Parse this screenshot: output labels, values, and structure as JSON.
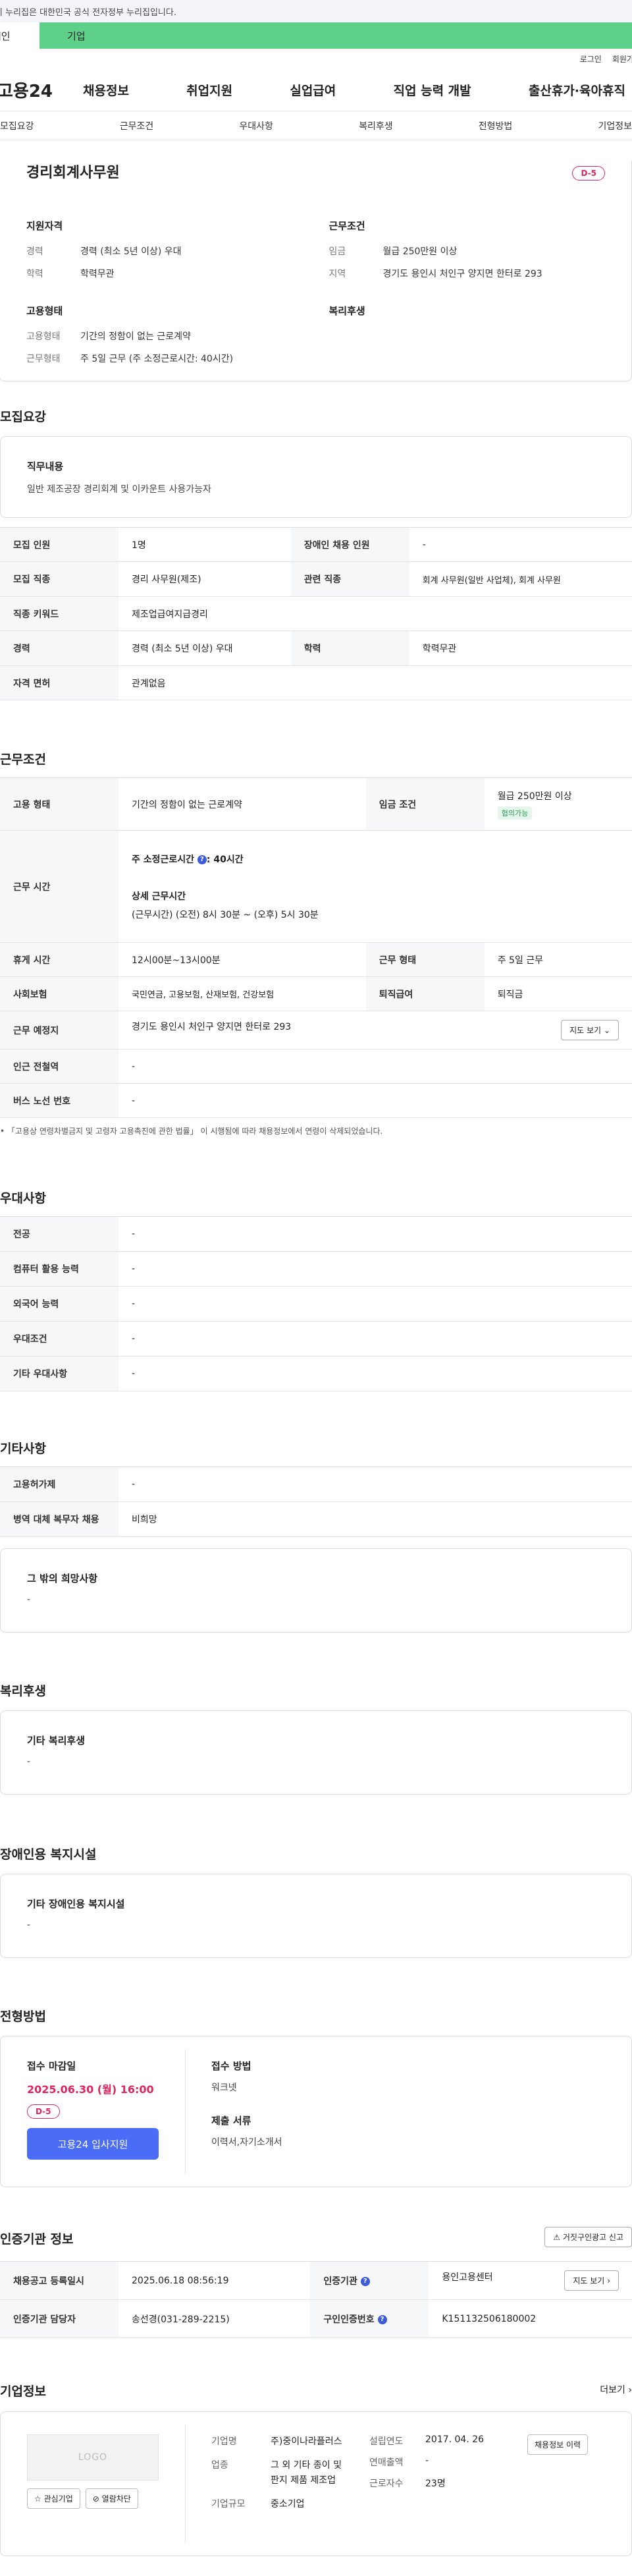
{
  "gov_banner": "이 누리집은 대한민국 공식 전자정부 누리집입니다.",
  "type_tabs": {
    "person": "개인",
    "corp": "기업"
  },
  "util": {
    "login": "로그인",
    "signup": "회원가입"
  },
  "gnb": {
    "logo": "고용24",
    "menu": [
      "채용정보",
      "취업지원",
      "실업급여",
      "직업 능력 개발",
      "출산휴가·육아휴직"
    ]
  },
  "subnav": [
    "모집요강",
    "근무조건",
    "우대사항",
    "복리후생",
    "전형방법",
    "기업정보"
  ],
  "summary": {
    "title": "경리회계사무원",
    "dday": "D-5",
    "qual_head": "지원자격",
    "qual": [
      {
        "k": "경력",
        "v": "경력 (최소 5년 이상) 우대"
      },
      {
        "k": "학력",
        "v": "학력무관"
      }
    ],
    "cond_head": "근무조건",
    "cond": [
      {
        "k": "임금",
        "v": "월급 250만원 이상"
      },
      {
        "k": "지역",
        "v": "경기도 용인시 처인구 양지면 한터로 293"
      }
    ],
    "emp_head": "고용형태",
    "emp": [
      {
        "k": "고용형태",
        "v": "기간의 정함이 없는 근로계약"
      },
      {
        "k": "근무형태",
        "v": "주 5일 근무 (주 소정근로시간: 40시간)"
      }
    ],
    "welfare_head": "복리후생"
  },
  "recruit": {
    "title": "모집요강",
    "duty_title": "직무내용",
    "duty_text": "일반 제조공장 경리회계 및 이카운트 사용가능자",
    "rows": [
      {
        "k1": "모집 인원",
        "v1": "1명",
        "k2": "장애인 채용 인원",
        "v2": "-"
      },
      {
        "k1": "모집 직종",
        "v1": "경리 사무원(제조)",
        "k2": "관련 직종",
        "v2": "회계 사무원(일반 사업체), 회계 사무원"
      },
      {
        "k1": "직종 키워드",
        "v1": "제조업급여지급경리"
      },
      {
        "k1": "경력",
        "v1": "경력 (최소 5년 이상) 우대",
        "k2": "학력",
        "v2": "학력무관"
      },
      {
        "k1": "자격 면허",
        "v1": "관계없음"
      }
    ]
  },
  "work": {
    "title": "근무조건",
    "emp_type_k": "고용 형태",
    "emp_type_v": "기간의 정함이 없는 근로계약",
    "wage_k": "임금 조건",
    "wage_v": "월급 250만원 이상",
    "wage_badge": "협의가능",
    "hours_k": "근무 시간",
    "hours_main": "주 소정근로시간",
    "hours_val": ": 40시간",
    "hours_detail_t": "상세 근무시간",
    "hours_detail_v": "(근무시간) (오전) 8시 30분 ~ (오후) 5시 30분",
    "break_k": "휴게 시간",
    "break_v": "12시00분~13시00분",
    "shape_k": "근무 형태",
    "shape_v": "주 5일 근무",
    "ins_k": "사회보험",
    "ins_v": "국민연금, 고용보험, 산재보험, 건강보험",
    "ret_k": "퇴직급여",
    "ret_v": "퇴직금",
    "place_k": "근무 예정지",
    "place_v": "경기도 용인시 처인구 양지면 한터로 293",
    "map_btn": "지도 보기",
    "subway_k": "인근 전철역",
    "subway_v": "-",
    "bus_k": "버스 노선 번호",
    "bus_v": "-",
    "note": "「고용상 연령차별금지 및 고령자 고용촉진에 관한 법률」 이 시행됨에 따라 채용정보에서 연령이 삭제되었습니다."
  },
  "pref": {
    "title": "우대사항",
    "rows": [
      {
        "k": "전공",
        "v": "-"
      },
      {
        "k": "컴퓨터 활용 능력",
        "v": "-"
      },
      {
        "k": "외국어 능력",
        "v": "-"
      },
      {
        "k": "우대조건",
        "v": "-"
      },
      {
        "k": "기타 우대사항",
        "v": "-"
      }
    ]
  },
  "etc": {
    "title": "기타사항",
    "rows": [
      {
        "k": "고용허가제",
        "v": "-"
      },
      {
        "k": "병역 대체 복무자 채용",
        "v": "비희망"
      }
    ],
    "other_t": "그 밖의 희망사항",
    "other_v": "-"
  },
  "welfare": {
    "title": "복리후생",
    "box_t": "기타 복리후생",
    "box_v": "-"
  },
  "disabled": {
    "title": "장애인용 복지시설",
    "box_t": "기타 장애인용 복지시설",
    "box_v": "-"
  },
  "apply": {
    "title": "전형방법",
    "deadline_t": "접수 마감일",
    "deadline_v": "2025.06.30 (월) 16:00",
    "dday": "D-5",
    "apply_btn": "고용24 입사지원",
    "method_t": "접수 방법",
    "method_v": "워크넷",
    "docs_t": "제출 서류",
    "docs_v": "이력서,자기소개서"
  },
  "cert": {
    "title": "인증기관 정보",
    "report_btn": "거짓구인광고 신고",
    "reg_k": "채용공고 등록일시",
    "reg_v": "2025.06.18 08:56:19",
    "org_k": "인증기관",
    "org_v": "용인고용센터",
    "map_btn": "지도 보기",
    "staff_k": "인증기관 담당자",
    "staff_v": "송선경(031-289-2215)",
    "num_k": "구인인증번호",
    "num_v": "K151132506180002"
  },
  "corp": {
    "title": "기업정보",
    "more": "더보기",
    "logo": "LOGO",
    "fav_btn": "관심기업",
    "block_btn": "열람차단",
    "name_k": "기업명",
    "name_v": "주)중이나라플러스",
    "biz_k": "업종",
    "biz_v": "그 외 기타 종이 및 판지 제품 제조업",
    "size_k": "기업규모",
    "size_v": "중소기업",
    "year_k": "설립연도",
    "year_v": "2017. 04. 26",
    "sales_k": "연매출액",
    "sales_v": "-",
    "emp_k": "근로자수",
    "emp_v": "23명",
    "history_btn": "채용정보 이력"
  }
}
